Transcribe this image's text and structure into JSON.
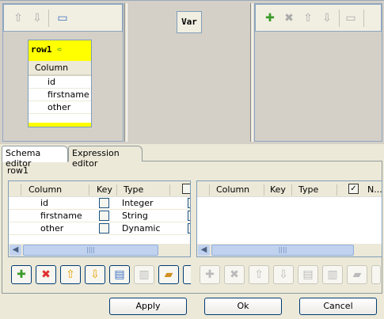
{
  "input_panel": {
    "toolbar": [
      {
        "icon": "arrow-up-icon"
      },
      {
        "icon": "arrow-down-icon"
      },
      {
        "icon": "minimize-icon"
      }
    ],
    "table": {
      "name": "row1",
      "column_header": "Column",
      "rows": [
        "id",
        "firstname",
        "other"
      ]
    }
  },
  "var_panel": {
    "label": "Var"
  },
  "output_panel": {
    "toolbar": [
      {
        "icon": "add-icon"
      },
      {
        "icon": "delete-icon"
      },
      {
        "icon": "arrow-up-icon"
      },
      {
        "icon": "arrow-down-icon"
      },
      {
        "icon": "minimize-icon"
      }
    ]
  },
  "tabs": [
    {
      "label": "Schema editor",
      "active": true
    },
    {
      "label": "Expression editor",
      "active": false
    }
  ],
  "schema": {
    "title": "row1",
    "left_table": {
      "headers": [
        "Column",
        "Key",
        "Type"
      ],
      "rows": [
        {
          "column": "id",
          "key": false,
          "type": "Integer"
        },
        {
          "column": "firstname",
          "key": false,
          "type": "String"
        },
        {
          "column": "other",
          "key": false,
          "type": "Dynamic"
        }
      ]
    },
    "right_table": {
      "headers": [
        "Column",
        "Key",
        "Type",
        "N..."
      ],
      "rows": []
    }
  },
  "buttons": {
    "apply": "Apply",
    "ok": "Ok",
    "cancel": "Cancel"
  }
}
